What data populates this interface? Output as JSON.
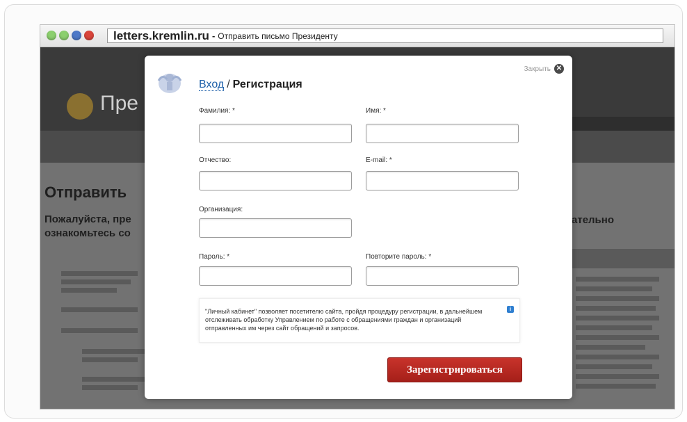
{
  "browser": {
    "domain": "letters.kremlin.ru",
    "separator": "-",
    "page_title": "Отправить письмо Президенту"
  },
  "background_page": {
    "logo_text": "Пре",
    "heading": "Отправить",
    "subheading_line1": "Пожалуйста, пре",
    "subheading_line2": "ознакомьтесь со",
    "subheading_right": "ательно"
  },
  "modal": {
    "close_label": "Закрыть",
    "title_login": "Вход",
    "title_separator": "/",
    "title_register": "Регистрация",
    "fields": {
      "surname": "Фамилия:",
      "name": "Имя:",
      "patronymic": "Отчество:",
      "email": "E-mail:",
      "organization": "Организация:",
      "password": "Пароль:",
      "password_repeat": "Повторите пароль:"
    },
    "required_mark": "*",
    "note": "\"Личный кабинет\" позволяет посетителю сайта, пройдя процедуру регистрации, в дальнейшем отслеживать обработку Управлением по работе с обращениями граждан и организаций отправленных им через сайт обращений и запросов.",
    "submit_label": "Зарегистрироваться"
  },
  "colors": {
    "link_blue": "#1b5ea8",
    "submit_red": "#b8281f",
    "overlay_gray": "#6a6a6a"
  }
}
